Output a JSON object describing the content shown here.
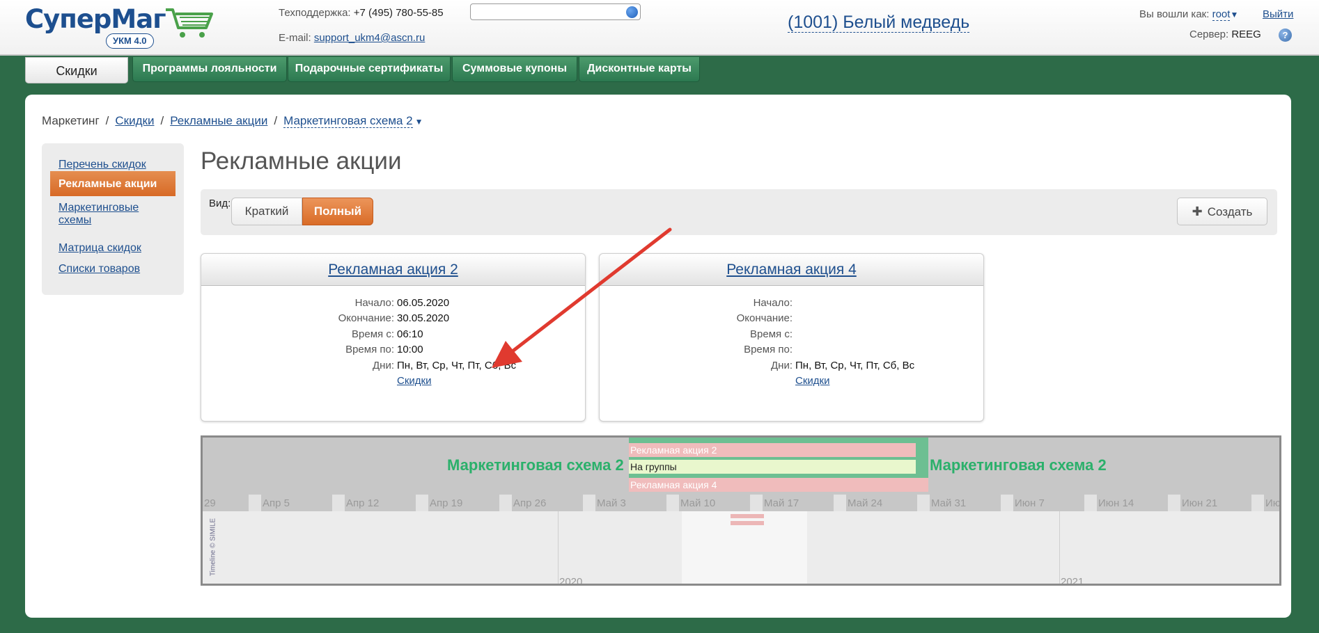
{
  "header": {
    "logo_part1": "Супер",
    "logo_part2": "Маг",
    "logo_badge": "УКМ 4.0",
    "support_label": "Техподдержка:",
    "support_phone": "+7 (495) 780-55-85",
    "email_label": "E-mail:",
    "email": "support_ukm4@ascn.ru",
    "search_placeholder": "",
    "store": "(1001) Белый медведь",
    "login_label": "Вы вошли как:",
    "login_user": "root",
    "logout": "Выйти",
    "server_label": "Сервер:",
    "server_name": "REEG",
    "help": "?"
  },
  "tabs": [
    {
      "label": "Скидки",
      "active": true
    },
    {
      "label": "Программы лояльности"
    },
    {
      "label": "Подарочные сертификаты"
    },
    {
      "label": "Суммовые купоны"
    },
    {
      "label": "Дисконтные карты"
    }
  ],
  "breadcrumb": [
    "Маркетинг",
    "Скидки",
    "Рекламные акции",
    "Маркетинговая схема 2"
  ],
  "sidebar": [
    {
      "label": "Перечень скидок"
    },
    {
      "label": "Рекламные акции",
      "active": true
    },
    {
      "label": "Маркетинговые схемы"
    },
    {
      "label": "Матрица скидок"
    },
    {
      "label": "Списки товаров"
    }
  ],
  "page_title": "Рекламные акции",
  "view": {
    "label": "Вид:",
    "brief": "Краткий",
    "full": "Полный",
    "create": "Создать"
  },
  "field_labels": {
    "start": "Начало:",
    "end": "Окончание:",
    "time_from": "Время с:",
    "time_to": "Время по:",
    "days": "Дни:"
  },
  "cards": [
    {
      "title": "Рекламная акция 2",
      "start": "06.05.2020",
      "end": "30.05.2020",
      "time_from": "06:10",
      "time_to": "10:00",
      "days": "Пн, Вт, Ср, Чт, Пт, Сб, Вс",
      "link": "Скидки"
    },
    {
      "title": "Рекламная акция 4",
      "start": "",
      "end": "",
      "time_from": "",
      "time_to": "",
      "days": "Пн, Вт, Ср, Чт, Пт, Сб, Вс",
      "link": "Скидки"
    }
  ],
  "timeline": {
    "scheme_left": "Маркетинговая схема 2",
    "scheme_right": "Маркетинговая схема 2",
    "events": [
      "Рекламная акция 2",
      "На группы",
      "Рекламная акция 4"
    ],
    "weeks": [
      "29",
      "Апр 5",
      "Апр 12",
      "Апр 19",
      "Апр 26",
      "Май 3",
      "Май 10",
      "Май 17",
      "Май 24",
      "Май 31",
      "Июн 7",
      "Июн 14",
      "Июн 21",
      "Июн"
    ],
    "years": [
      "2020",
      "2021"
    ],
    "credit": "Timeline © SIMILE"
  },
  "colors": {
    "green_bg": "#2d6b48",
    "accent_orange": "#d96c28",
    "link_blue": "#1e4f8e",
    "scheme_green": "#2bb06b",
    "annotation_red": "#e03a2f"
  }
}
